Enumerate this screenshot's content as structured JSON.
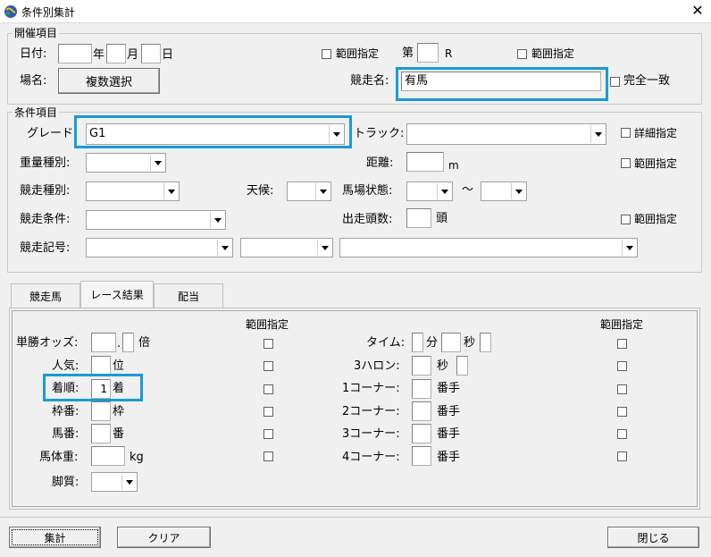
{
  "window": {
    "title": "条件別集計",
    "close": "✕"
  },
  "kaisai": {
    "legend": "開催項目",
    "date_label": "日付:",
    "year": "年",
    "month": "月",
    "day": "日",
    "range_label": "範囲指定",
    "dai": "第",
    "race_unit": "R",
    "range_label2": "範囲指定",
    "place_label": "場名:",
    "multi_select": "複数選択",
    "race_name_label": "競走名:",
    "race_name_value": "有馬",
    "exact_match": "完全一致"
  },
  "joken": {
    "legend": "条件項目",
    "grade_label": "グレード",
    "grade_value": "G1",
    "track_label": "トラック:",
    "detail_label": "詳細指定",
    "weight_type_label": "重量種別:",
    "distance_label": "距離:",
    "distance_unit": "m",
    "range_label": "範囲指定",
    "race_type_label": "競走種別:",
    "weather_label": "天候:",
    "baba_label": "馬場状態:",
    "tilde": "～",
    "race_cond_label": "競走条件:",
    "runners_label": "出走頭数:",
    "runners_unit": "頭",
    "range_label2": "範囲指定",
    "race_symbol_label": "競走記号:"
  },
  "tabs": [
    "競走馬",
    "レース結果",
    "配当"
  ],
  "result": {
    "range_header_left": "範囲指定",
    "range_header_right": "範囲指定",
    "odds_label": "単勝オッズ:",
    "odds_dot": ".",
    "odds_unit": "倍",
    "pop_label": "人気:",
    "pop_unit": "位",
    "finish_label": "着順:",
    "finish_value": "1",
    "finish_unit": "着",
    "waku_label": "枠番:",
    "waku_unit": "枠",
    "umaban_label": "馬番:",
    "umaban_unit": "番",
    "weight_label": "馬体重:",
    "weight_unit": "kg",
    "kyakushitsu_label": "脚質:",
    "time_label": "タイム:",
    "time_min": "分",
    "time_sec": "秒",
    "halon_label": "3ハロン:",
    "halon_sec": "秒",
    "c1_label": "1コーナー:",
    "c2_label": "2コーナー:",
    "c3_label": "3コーナー:",
    "c4_label": "4コーナー:",
    "corner_unit": "番手"
  },
  "buttons": {
    "aggregate": "集計",
    "clear": "クリア",
    "close": "閉じる"
  }
}
